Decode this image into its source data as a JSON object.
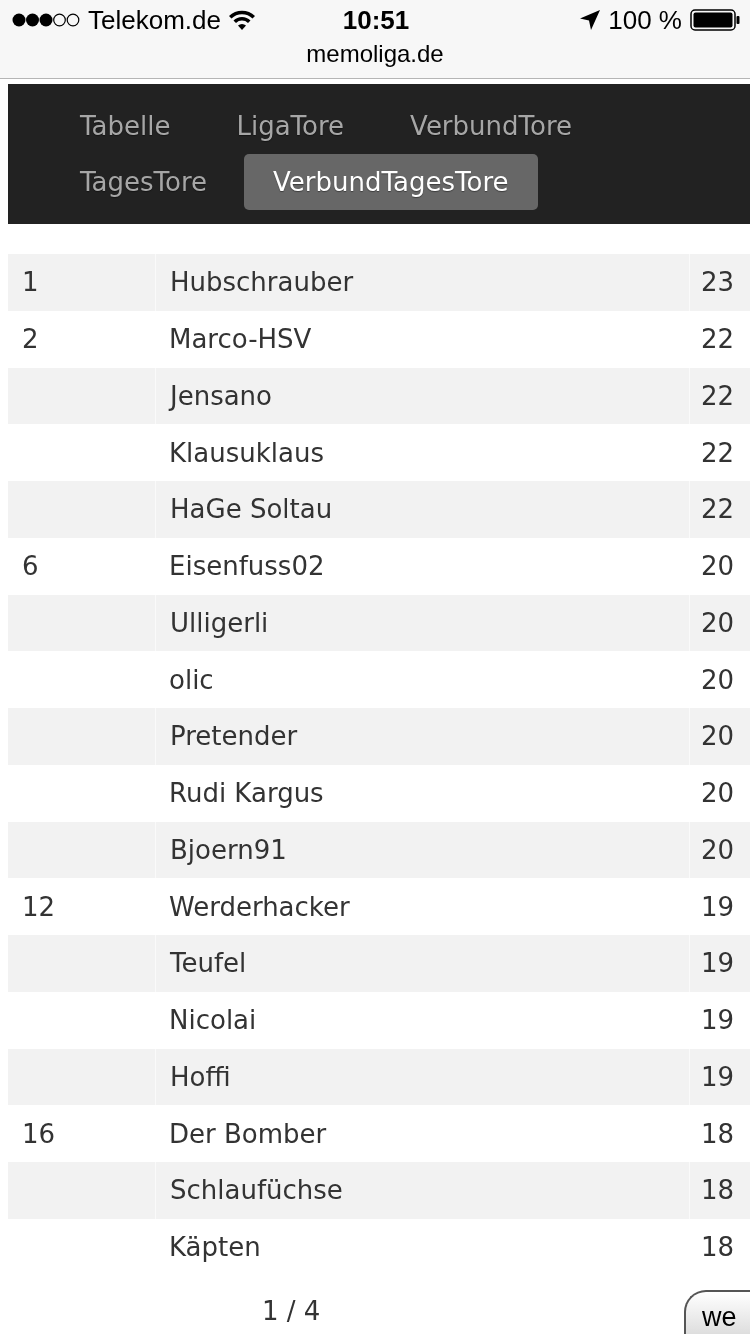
{
  "status_bar": {
    "carrier": "Telekom.de",
    "time": "10:51",
    "battery": "100 %"
  },
  "address_bar": {
    "url": "memoliga.de"
  },
  "nav": {
    "tabs": [
      {
        "label": "Tabelle",
        "selected": false
      },
      {
        "label": "LigaTore",
        "selected": false
      },
      {
        "label": "VerbundTore",
        "selected": false
      },
      {
        "label": "TagesTore",
        "selected": false
      },
      {
        "label": "VerbundTagesTore",
        "selected": true
      }
    ]
  },
  "table": {
    "rows": [
      {
        "rank": "1",
        "name": "Hubschrauber",
        "score": "23"
      },
      {
        "rank": "2",
        "name": "Marco-HSV",
        "score": "22"
      },
      {
        "name": "Jensano",
        "score": "22"
      },
      {
        "name": "Klausuklaus",
        "score": "22"
      },
      {
        "name": "HaGe Soltau",
        "score": "22"
      },
      {
        "rank": "6",
        "name": "Eisenfuss02",
        "score": "20"
      },
      {
        "name": "Ulligerli",
        "score": "20"
      },
      {
        "name": "olic",
        "score": "20"
      },
      {
        "name": "Pretender",
        "score": "20"
      },
      {
        "name": "Rudi Kargus",
        "score": "20"
      },
      {
        "name": "Bjoern91",
        "score": "20"
      },
      {
        "rank": "12",
        "name": "Werderhacker",
        "score": "19"
      },
      {
        "name": "Teufel",
        "score": "19"
      },
      {
        "name": "Nicolai",
        "score": "19"
      },
      {
        "name": "Hoffi",
        "score": "19"
      },
      {
        "rank": "16",
        "name": "Der Bomber",
        "score": "18"
      },
      {
        "name": "Schlaufüchse",
        "score": "18"
      },
      {
        "name": "Käpten",
        "score": "18"
      }
    ]
  },
  "pagination": {
    "page": "1 / 4",
    "next_button": "we"
  }
}
